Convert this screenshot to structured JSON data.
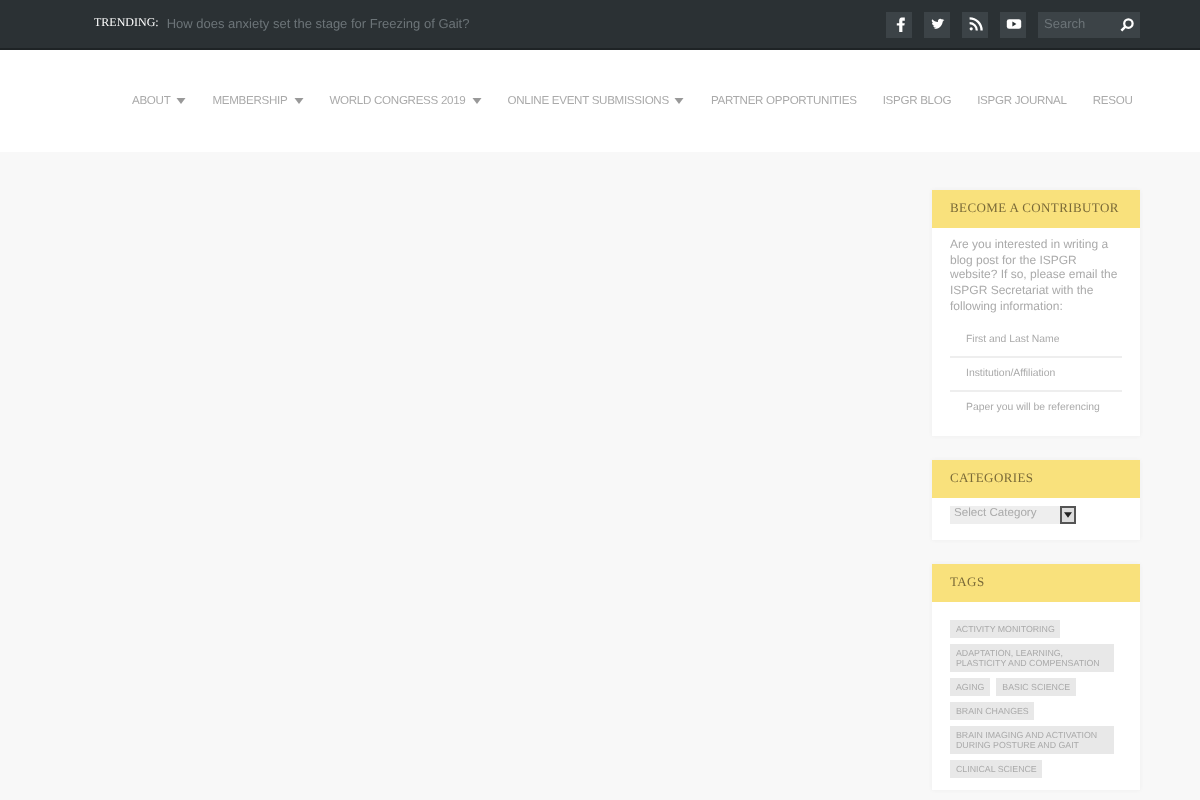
{
  "topbar": {
    "trending_label": "TRENDING:",
    "trending_text": "How does anxiety set the stage for Freezing of Gait?",
    "social": [
      {
        "kind": "facebook"
      },
      {
        "kind": "twitter"
      },
      {
        "kind": "rss"
      },
      {
        "kind": "youtube"
      }
    ],
    "search": {
      "placeholder": "Search"
    }
  },
  "nav": [
    {
      "label": "ABOUT",
      "dropdown": true
    },
    {
      "label": "MEMBERSHIP",
      "dropdown": true
    },
    {
      "label": "WORLD CONGRESS 2019",
      "dropdown": true
    },
    {
      "label": "ONLINE EVENT SUBMISSIONS",
      "dropdown": true
    },
    {
      "label": "PARTNER OPPORTUNITIES",
      "dropdown": false
    },
    {
      "label": "ISPGR BLOG",
      "dropdown": false
    },
    {
      "label": "ISPGR JOURNAL",
      "dropdown": false
    },
    {
      "label": "RESOU",
      "dropdown": false
    }
  ],
  "contributor": {
    "title": "BECOME A CONTRIBUTOR",
    "text": "Are you interested in writing a blog post for the ISPGR website? If so, please email the ISPGR Secretariat with the following information:",
    "items": [
      "First and Last Name",
      "Institution/Affiliation",
      "Paper you will be referencing"
    ]
  },
  "categories": {
    "title": "CATEGORIES",
    "select": "Select Category"
  },
  "tags": {
    "title": "TAGS",
    "items": [
      "ACTIVITY MONITORING",
      "ADAPTATION, LEARNING, PLASTICITY AND COMPENSATION",
      "AGING",
      "BASIC SCIENCE",
      "BRAIN CHANGES",
      "BRAIN IMAGING AND ACTIVATION DURING POSTURE AND GAIT",
      "CLINICAL SCIENCE"
    ]
  }
}
